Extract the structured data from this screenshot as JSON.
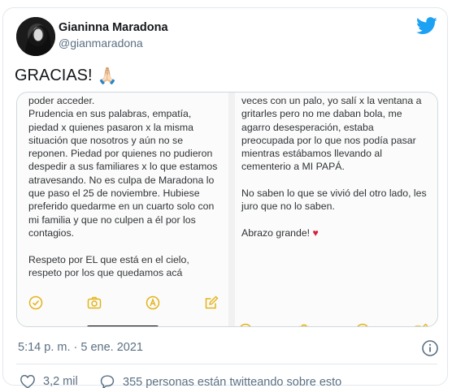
{
  "author": {
    "name": "Gianinna Maradona",
    "handle": "@gianmaradona"
  },
  "tweet": {
    "text": "GRACIAS!",
    "emoji": "🙏🏻"
  },
  "media": {
    "left_column_text": "poder acceder.\nPrudencia en sus palabras, empatía,\npiedad x quienes pasaron x la misma\nsituación que nosotros y aún no se\nreponen. Piedad por quienes no pudieron\ndespedir a sus familiares x lo que estamos\natravesando. No es culpa de Maradona lo\nque paso el 25 de noviembre. Hubiese\npreferido quedarme en un cuarto solo con\nmi familia y que no culpen a él por los\ncontagios.\n\nRespeto por EL que está en el cielo,\nrespeto por los que quedamos acá",
    "right_column_text": "veces con un palo, yo salí x la ventana a\ngritarles pero no me daban bola, me\nagarro desesperación, estaba\npreocupada por lo que nos podía pasar\nmientras estábamos llevando al\ncementerio a MI PAPÁ.\n\nNo saben lo que se vivió del otro lado, les\njuro que no lo saben.\n\nAbrazo grande!",
    "heart_emoji": "♥",
    "toolbar_icons": [
      "check-circle-icon",
      "camera-icon",
      "pen-tip-icon",
      "edit-icon"
    ]
  },
  "meta": {
    "timestamp": "5:14 p. m. · 5 ene. 2021"
  },
  "stats": {
    "likes": "3,2 mil",
    "conversation": "355 personas están twitteando sobre esto"
  },
  "colors": {
    "twitter_blue": "#1da1f2",
    "icon_yellow": "#e3b31b",
    "secondary_text": "#5b7083",
    "border": "#e1e8ed"
  }
}
